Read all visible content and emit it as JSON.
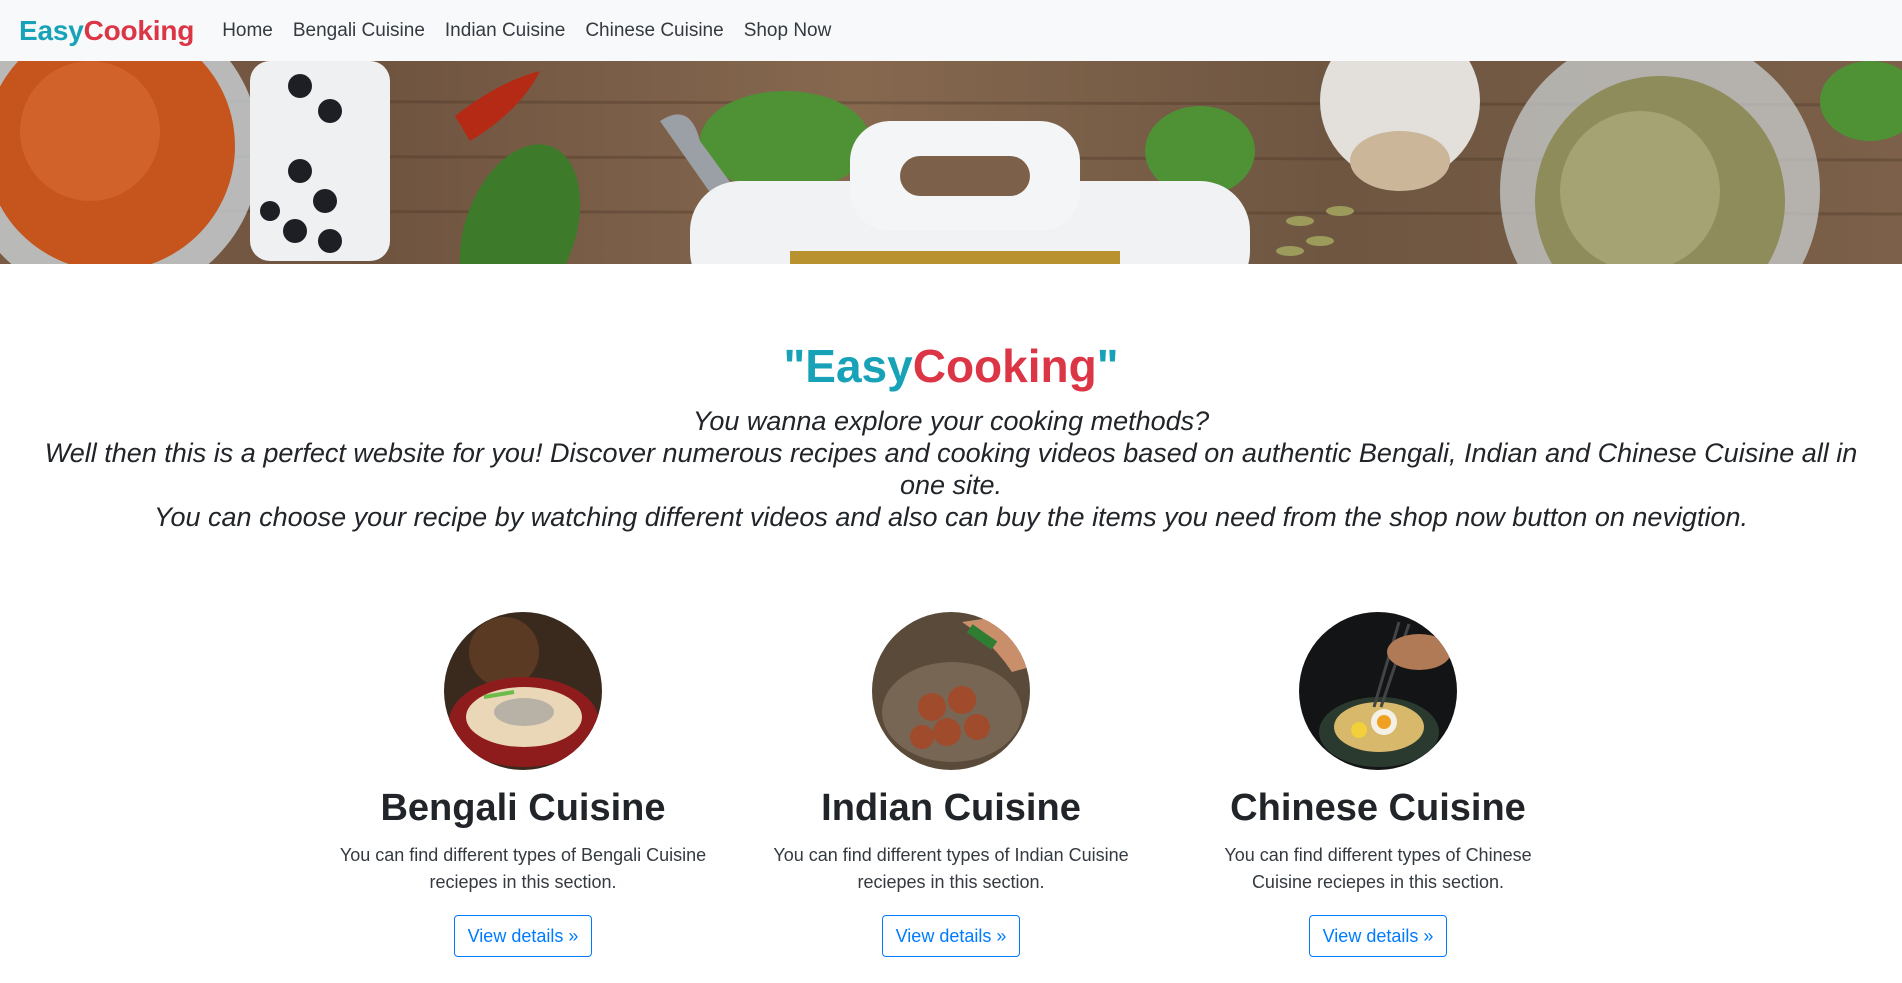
{
  "nav": {
    "brand_part1": "Easy",
    "brand_part2": "Cooking",
    "links": [
      "Home",
      "Bengali Cuisine",
      "Indian Cuisine",
      "Chinese Cuisine",
      "Shop Now"
    ]
  },
  "intro": {
    "quote_open": "\"",
    "title_part1": "Easy",
    "title_part2": "Cooking",
    "quote_close": "\"",
    "lines": [
      "You wanna explore your cooking methods?",
      "Well then this is a perfect website for you! Discover numerous recipes and cooking videos based on authentic Bengali, Indian and Chinese Cuisine all in one site.",
      "You can choose your recipe by watching different videos and also can buy the items you need from the shop now button on nevigtion."
    ]
  },
  "cards": [
    {
      "title": "Bengali Cuisine",
      "description": "You can find different types of Bengali Cuisine reciepes in this section.",
      "button": "View details »"
    },
    {
      "title": "Indian Cuisine",
      "description": "You can find different types of Indian Cuisine reciepes in this section.",
      "button": "View details »"
    },
    {
      "title": "Chinese Cuisine",
      "description": "You can find different types of Chinese Cuisine reciepes in this section.",
      "button": "View details »"
    }
  ],
  "colors": {
    "brand_teal": "#17a2b8",
    "brand_red": "#dc3545",
    "link_blue": "#007bff",
    "navbar_bg": "#f8f9fa"
  }
}
